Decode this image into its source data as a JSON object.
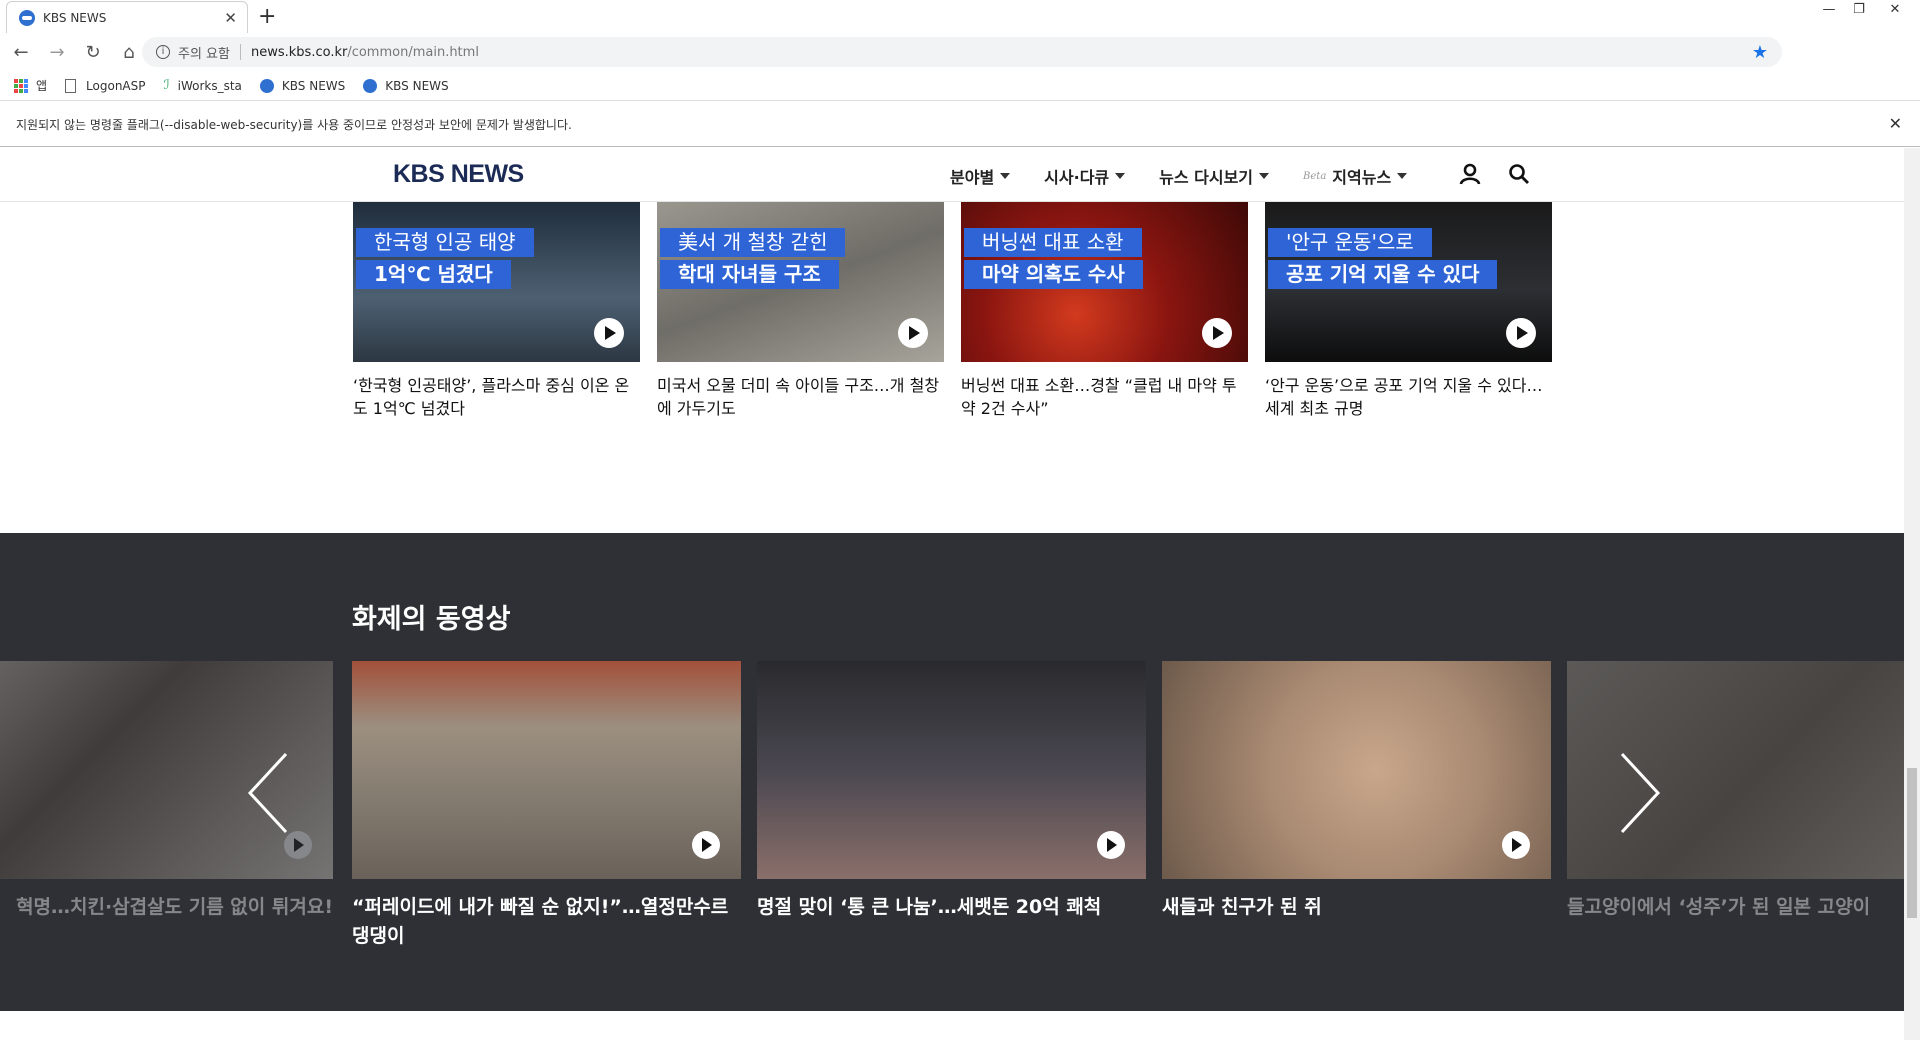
{
  "browser": {
    "tab_title": "KBS NEWS",
    "new_tab": "+",
    "security_warning": "주의 요함",
    "url_host": "news.kbs.co.kr",
    "url_path": "/common/main.html",
    "bookmarks": [
      {
        "label": "앱",
        "icon": "apps-icon"
      },
      {
        "label": "LogonASP",
        "icon": "document-icon"
      },
      {
        "label": "iWorks_sta",
        "icon": "iworks-icon"
      },
      {
        "label": "KBS NEWS",
        "icon": "kbs-icon"
      },
      {
        "label": "KBS NEWS",
        "icon": "kbs-icon"
      }
    ],
    "infobar_text": "지원되지 않는 명령줄 플래그(--disable-web-security)를 사용 중이므로 안정성과 보안에 문제가 발생합니다."
  },
  "site": {
    "logo": "KBS NEWS",
    "nav": [
      {
        "label": "분야별"
      },
      {
        "label": "시사·다큐"
      },
      {
        "label": "뉴스 다시보기"
      },
      {
        "label": "지역뉴스",
        "badge": "Beta"
      }
    ]
  },
  "news_cards": [
    {
      "cap1": "한국형 인공 태양",
      "cap2": "1억℃ 넘겼다",
      "title": "‘한국형 인공태양’, 플라스마 중심 이온 온도 1억℃ 넘겼다",
      "bg": "#3b4a5a"
    },
    {
      "cap1": "美서 개 철창 갇힌",
      "cap2": "학대 자녀들 구조",
      "title": "미국서 오물 더미 속 아이들 구조…개 철창에 가두기도",
      "bg": "#7d7b74"
    },
    {
      "cap1": "버닝썬 대표 소환",
      "cap2": "마약 의혹도 수사",
      "title": "버닝썬 대표 소환…경찰 “클럽 내 마약 투약 2건 수사”",
      "bg": "#8a1510"
    },
    {
      "cap1": "'안구 운동'으로",
      "cap2": "공포 기억 지울 수 있다",
      "title": "‘안구 운동’으로 공포 기억 지울 수 있다…세계 최초 규명",
      "bg": "#1c1c1c"
    }
  ],
  "video_section": {
    "heading": "화제의 동영상",
    "videos": [
      {
        "title": "혁명…치킨·삼겹살도 기름 없이 튀겨요!",
        "bg": "#a39d93",
        "dim": true
      },
      {
        "title": "“퍼레이드에 내가 빠질 순 없지!”…열정만수르",
        "title2": "댕댕이",
        "bg": "#8e7f6e",
        "dim": false
      },
      {
        "title": "명절 맞이 ‘통 큰 나눔’…세뱃돈 20억 쾌척",
        "bg": "#3f3d40",
        "dim": false
      },
      {
        "title": "새들과 친구가 된 쥐",
        "bg": "#b99c82",
        "dim": false
      },
      {
        "title": "들고양이에서 ‘성주’가 된 일본 고양이",
        "bg": "#8c8478",
        "dim": true
      }
    ]
  },
  "colors": {
    "caption_blue": "#2e64d6",
    "dark_section": "#2e3036",
    "logo_navy": "#1b2b56"
  }
}
